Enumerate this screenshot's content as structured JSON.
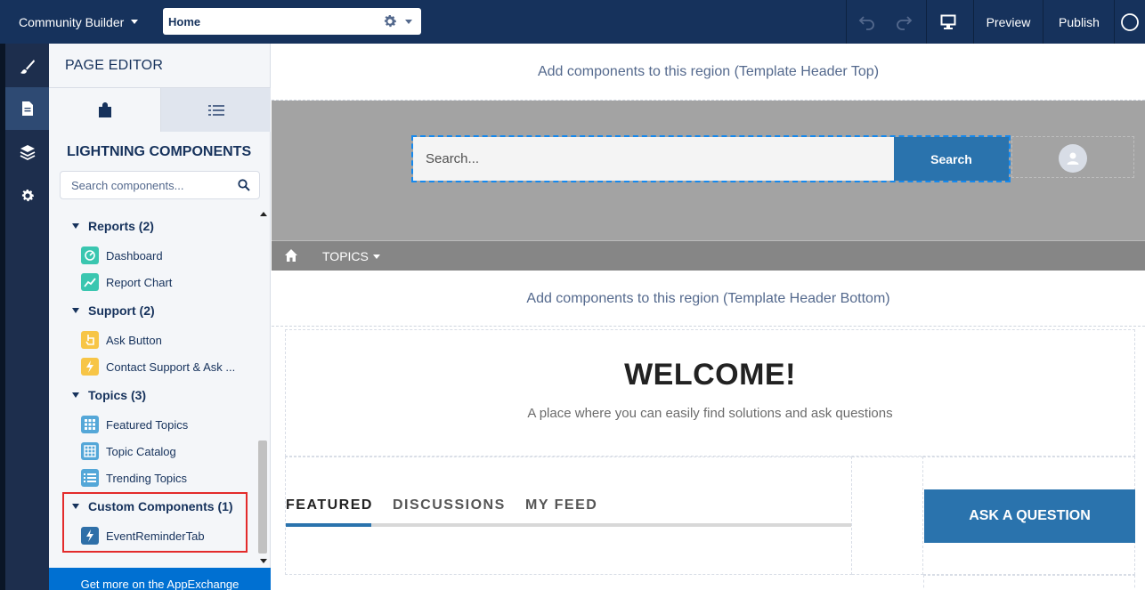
{
  "topbar": {
    "app_name": "Community Builder",
    "page_name": "Home",
    "preview_label": "Preview",
    "publish_label": "Publish"
  },
  "rail": {
    "items": [
      {
        "icon": "paintbrush-icon"
      },
      {
        "icon": "page-icon",
        "active": true
      },
      {
        "icon": "layers-icon"
      },
      {
        "icon": "gear-icon"
      }
    ]
  },
  "panel": {
    "title": "PAGE EDITOR",
    "section_title": "LIGHTNING COMPONENTS",
    "search_placeholder": "Search components...",
    "categories": [
      {
        "label": "Reports (2)",
        "items": [
          {
            "label": "Dashboard",
            "icon": "dashboard-icon",
            "color": "#3ac6b0"
          },
          {
            "label": "Report Chart",
            "icon": "report-chart-icon",
            "color": "#3ac6b0"
          }
        ]
      },
      {
        "label": "Support (2)",
        "items": [
          {
            "label": "Ask Button",
            "icon": "hand-icon",
            "color": "#f7c547"
          },
          {
            "label": "Contact Support & Ask ...",
            "icon": "lightning-icon",
            "color": "#f7c547"
          }
        ]
      },
      {
        "label": "Topics (3)",
        "items": [
          {
            "label": "Featured Topics",
            "icon": "grid-icon",
            "color": "#54a7d8"
          },
          {
            "label": "Topic Catalog",
            "icon": "table-icon",
            "color": "#54a7d8"
          },
          {
            "label": "Trending Topics",
            "icon": "list-icon",
            "color": "#54a7d8"
          }
        ]
      },
      {
        "label": "Custom Components (1)",
        "items": [
          {
            "label": "EventReminderTab",
            "icon": "lightning-icon",
            "color": "#2e6fa8"
          }
        ]
      }
    ],
    "appexchange_label": "Get more on the AppExchange"
  },
  "canvas": {
    "region_top": "Add components to this region (Template Header Top)",
    "search_placeholder": "Search...",
    "search_button": "Search",
    "nav_topics": "TOPICS",
    "region_bottom": "Add components to this region (Template Header Bottom)",
    "welcome_title": "WELCOME!",
    "welcome_sub": "A place where you can easily find solutions and ask questions",
    "tabs": [
      "FEATURED",
      "DISCUSSIONS",
      "MY FEED"
    ],
    "ask_button": "ASK A QUESTION"
  },
  "colors": {
    "topbar": "#16325c",
    "accent": "#2a73ad",
    "highlight": "#e32b2b"
  }
}
